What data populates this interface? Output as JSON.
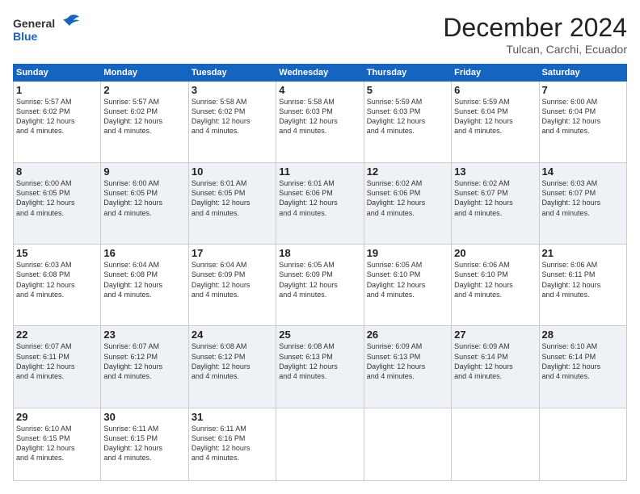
{
  "header": {
    "logo_general": "General",
    "logo_blue": "Blue",
    "month_title": "December 2024",
    "location": "Tulcan, Carchi, Ecuador"
  },
  "weekdays": [
    "Sunday",
    "Monday",
    "Tuesday",
    "Wednesday",
    "Thursday",
    "Friday",
    "Saturday"
  ],
  "weeks": [
    [
      {
        "day": "1",
        "info": "Sunrise: 5:57 AM\nSunset: 6:02 PM\nDaylight: 12 hours\nand 4 minutes."
      },
      {
        "day": "2",
        "info": "Sunrise: 5:57 AM\nSunset: 6:02 PM\nDaylight: 12 hours\nand 4 minutes."
      },
      {
        "day": "3",
        "info": "Sunrise: 5:58 AM\nSunset: 6:02 PM\nDaylight: 12 hours\nand 4 minutes."
      },
      {
        "day": "4",
        "info": "Sunrise: 5:58 AM\nSunset: 6:03 PM\nDaylight: 12 hours\nand 4 minutes."
      },
      {
        "day": "5",
        "info": "Sunrise: 5:59 AM\nSunset: 6:03 PM\nDaylight: 12 hours\nand 4 minutes."
      },
      {
        "day": "6",
        "info": "Sunrise: 5:59 AM\nSunset: 6:04 PM\nDaylight: 12 hours\nand 4 minutes."
      },
      {
        "day": "7",
        "info": "Sunrise: 6:00 AM\nSunset: 6:04 PM\nDaylight: 12 hours\nand 4 minutes."
      }
    ],
    [
      {
        "day": "8",
        "info": "Sunrise: 6:00 AM\nSunset: 6:05 PM\nDaylight: 12 hours\nand 4 minutes."
      },
      {
        "day": "9",
        "info": "Sunrise: 6:00 AM\nSunset: 6:05 PM\nDaylight: 12 hours\nand 4 minutes."
      },
      {
        "day": "10",
        "info": "Sunrise: 6:01 AM\nSunset: 6:05 PM\nDaylight: 12 hours\nand 4 minutes."
      },
      {
        "day": "11",
        "info": "Sunrise: 6:01 AM\nSunset: 6:06 PM\nDaylight: 12 hours\nand 4 minutes."
      },
      {
        "day": "12",
        "info": "Sunrise: 6:02 AM\nSunset: 6:06 PM\nDaylight: 12 hours\nand 4 minutes."
      },
      {
        "day": "13",
        "info": "Sunrise: 6:02 AM\nSunset: 6:07 PM\nDaylight: 12 hours\nand 4 minutes."
      },
      {
        "day": "14",
        "info": "Sunrise: 6:03 AM\nSunset: 6:07 PM\nDaylight: 12 hours\nand 4 minutes."
      }
    ],
    [
      {
        "day": "15",
        "info": "Sunrise: 6:03 AM\nSunset: 6:08 PM\nDaylight: 12 hours\nand 4 minutes."
      },
      {
        "day": "16",
        "info": "Sunrise: 6:04 AM\nSunset: 6:08 PM\nDaylight: 12 hours\nand 4 minutes."
      },
      {
        "day": "17",
        "info": "Sunrise: 6:04 AM\nSunset: 6:09 PM\nDaylight: 12 hours\nand 4 minutes."
      },
      {
        "day": "18",
        "info": "Sunrise: 6:05 AM\nSunset: 6:09 PM\nDaylight: 12 hours\nand 4 minutes."
      },
      {
        "day": "19",
        "info": "Sunrise: 6:05 AM\nSunset: 6:10 PM\nDaylight: 12 hours\nand 4 minutes."
      },
      {
        "day": "20",
        "info": "Sunrise: 6:06 AM\nSunset: 6:10 PM\nDaylight: 12 hours\nand 4 minutes."
      },
      {
        "day": "21",
        "info": "Sunrise: 6:06 AM\nSunset: 6:11 PM\nDaylight: 12 hours\nand 4 minutes."
      }
    ],
    [
      {
        "day": "22",
        "info": "Sunrise: 6:07 AM\nSunset: 6:11 PM\nDaylight: 12 hours\nand 4 minutes."
      },
      {
        "day": "23",
        "info": "Sunrise: 6:07 AM\nSunset: 6:12 PM\nDaylight: 12 hours\nand 4 minutes."
      },
      {
        "day": "24",
        "info": "Sunrise: 6:08 AM\nSunset: 6:12 PM\nDaylight: 12 hours\nand 4 minutes."
      },
      {
        "day": "25",
        "info": "Sunrise: 6:08 AM\nSunset: 6:13 PM\nDaylight: 12 hours\nand 4 minutes."
      },
      {
        "day": "26",
        "info": "Sunrise: 6:09 AM\nSunset: 6:13 PM\nDaylight: 12 hours\nand 4 minutes."
      },
      {
        "day": "27",
        "info": "Sunrise: 6:09 AM\nSunset: 6:14 PM\nDaylight: 12 hours\nand 4 minutes."
      },
      {
        "day": "28",
        "info": "Sunrise: 6:10 AM\nSunset: 6:14 PM\nDaylight: 12 hours\nand 4 minutes."
      }
    ],
    [
      {
        "day": "29",
        "info": "Sunrise: 6:10 AM\nSunset: 6:15 PM\nDaylight: 12 hours\nand 4 minutes."
      },
      {
        "day": "30",
        "info": "Sunrise: 6:11 AM\nSunset: 6:15 PM\nDaylight: 12 hours\nand 4 minutes."
      },
      {
        "day": "31",
        "info": "Sunrise: 6:11 AM\nSunset: 6:16 PM\nDaylight: 12 hours\nand 4 minutes."
      },
      {
        "day": "",
        "info": ""
      },
      {
        "day": "",
        "info": ""
      },
      {
        "day": "",
        "info": ""
      },
      {
        "day": "",
        "info": ""
      }
    ]
  ]
}
